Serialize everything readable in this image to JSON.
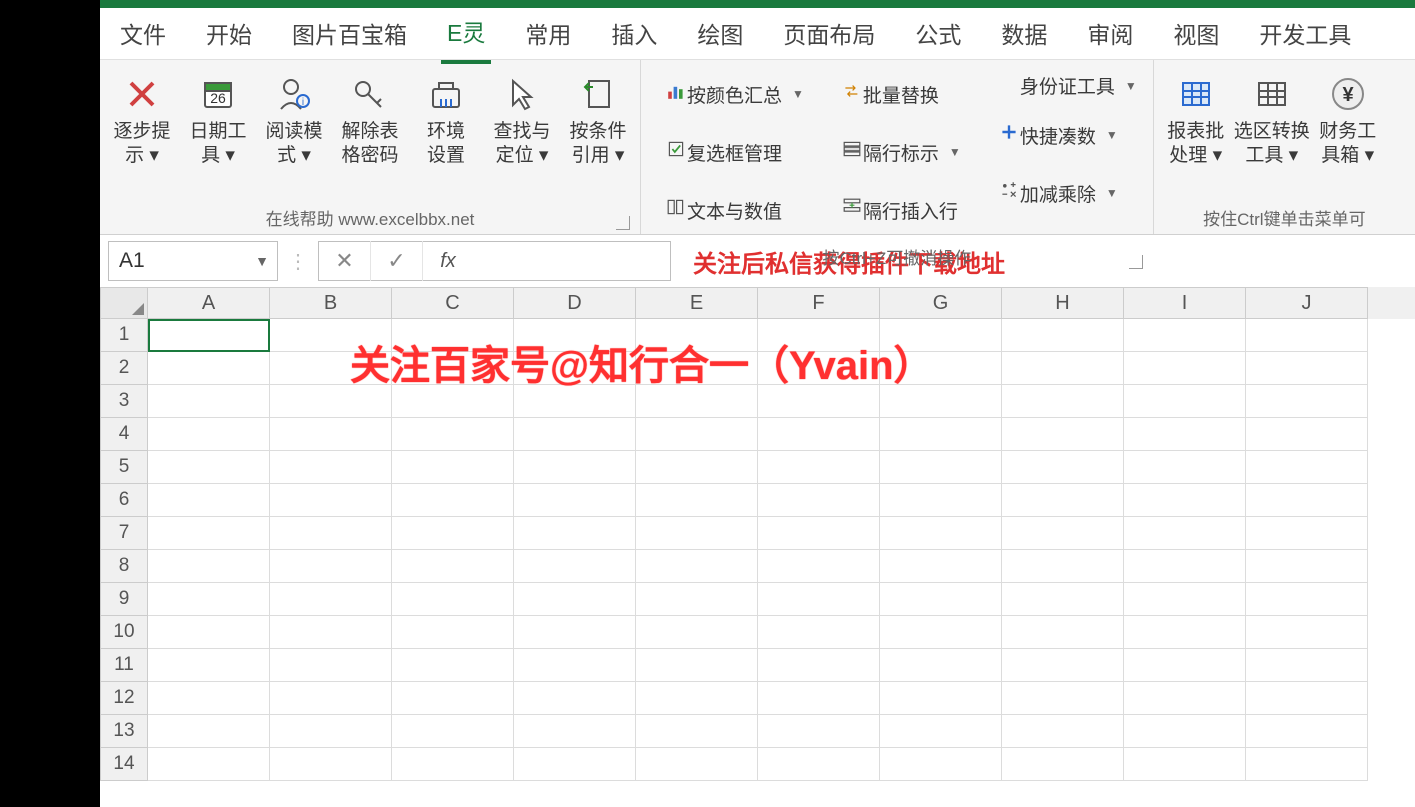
{
  "tabs": [
    "文件",
    "开始",
    "图片百宝箱",
    "E灵",
    "常用",
    "插入",
    "绘图",
    "页面布局",
    "公式",
    "数据",
    "审阅",
    "视图",
    "开发工具"
  ],
  "active_tab": "E灵",
  "ribbon": {
    "group1": {
      "items": [
        {
          "label": "逐步提\n示 ▾",
          "icon": "x-red"
        },
        {
          "label": "日期工\n具 ▾",
          "icon": "calendar"
        },
        {
          "label": "阅读模\n式 ▾",
          "icon": "person"
        },
        {
          "label": "解除表\n格密码",
          "icon": "key"
        },
        {
          "label": "环境\n设置",
          "icon": "toolbox"
        },
        {
          "label": "查找与\n定位 ▾",
          "icon": "cursor"
        },
        {
          "label": "按条件\n引用 ▾",
          "icon": "sheet-arrow"
        }
      ],
      "caption": "在线帮助  www.excelbbx.net"
    },
    "group2": {
      "col1": [
        {
          "label": "按颜色汇总",
          "dd": true,
          "icon": "bar"
        },
        {
          "label": "复选框管理",
          "icon": "checkbox"
        },
        {
          "label": "文本与数值",
          "icon": "text-cols"
        }
      ],
      "col2": [
        {
          "label": "批量替换",
          "icon": "exchange"
        },
        {
          "label": "隔行标示",
          "dd": true,
          "icon": "rows"
        },
        {
          "label": "隔行插入行",
          "icon": "rows-insert"
        }
      ],
      "col3": [
        {
          "label": "身份证工具",
          "dd": true,
          "icon": ""
        },
        {
          "label": "快捷凑数",
          "dd": true,
          "icon": "plus-blue"
        },
        {
          "label": "加减乘除",
          "dd": true,
          "icon": "math"
        }
      ],
      "caption": "按Ctrl+Z可撤消操作"
    },
    "group3": {
      "items": [
        {
          "label": "报表批\n处理 ▾",
          "icon": "table-blue"
        },
        {
          "label": "选区转换\n工具 ▾",
          "icon": "grid"
        },
        {
          "label": "财务工\n具箱 ▾",
          "icon": "yen"
        }
      ],
      "caption": "按住Ctrl键单击菜单可"
    }
  },
  "namebox": "A1",
  "formula_text": "关注后私信获得插件下载地址",
  "columns": [
    "A",
    "B",
    "C",
    "D",
    "E",
    "F",
    "G",
    "H",
    "I",
    "J"
  ],
  "rows": [
    "1",
    "2",
    "3",
    "4",
    "5",
    "6",
    "7",
    "8",
    "9",
    "10",
    "11",
    "12",
    "13",
    "14"
  ],
  "overlay_text": "关注百家号@知行合一（Yvain）"
}
